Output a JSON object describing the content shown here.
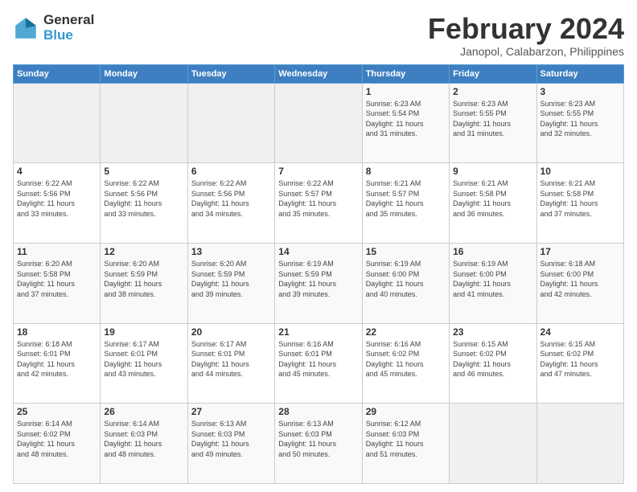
{
  "header": {
    "logo_general": "General",
    "logo_blue": "Blue",
    "month_title": "February 2024",
    "location": "Janopol, Calabarzon, Philippines"
  },
  "columns": [
    "Sunday",
    "Monday",
    "Tuesday",
    "Wednesday",
    "Thursday",
    "Friday",
    "Saturday"
  ],
  "weeks": [
    [
      {
        "day": "",
        "info": ""
      },
      {
        "day": "",
        "info": ""
      },
      {
        "day": "",
        "info": ""
      },
      {
        "day": "",
        "info": ""
      },
      {
        "day": "1",
        "info": "Sunrise: 6:23 AM\nSunset: 5:54 PM\nDaylight: 11 hours\nand 31 minutes."
      },
      {
        "day": "2",
        "info": "Sunrise: 6:23 AM\nSunset: 5:55 PM\nDaylight: 11 hours\nand 31 minutes."
      },
      {
        "day": "3",
        "info": "Sunrise: 6:23 AM\nSunset: 5:55 PM\nDaylight: 11 hours\nand 32 minutes."
      }
    ],
    [
      {
        "day": "4",
        "info": "Sunrise: 6:22 AM\nSunset: 5:56 PM\nDaylight: 11 hours\nand 33 minutes."
      },
      {
        "day": "5",
        "info": "Sunrise: 6:22 AM\nSunset: 5:56 PM\nDaylight: 11 hours\nand 33 minutes."
      },
      {
        "day": "6",
        "info": "Sunrise: 6:22 AM\nSunset: 5:56 PM\nDaylight: 11 hours\nand 34 minutes."
      },
      {
        "day": "7",
        "info": "Sunrise: 6:22 AM\nSunset: 5:57 PM\nDaylight: 11 hours\nand 35 minutes."
      },
      {
        "day": "8",
        "info": "Sunrise: 6:21 AM\nSunset: 5:57 PM\nDaylight: 11 hours\nand 35 minutes."
      },
      {
        "day": "9",
        "info": "Sunrise: 6:21 AM\nSunset: 5:58 PM\nDaylight: 11 hours\nand 36 minutes."
      },
      {
        "day": "10",
        "info": "Sunrise: 6:21 AM\nSunset: 5:58 PM\nDaylight: 11 hours\nand 37 minutes."
      }
    ],
    [
      {
        "day": "11",
        "info": "Sunrise: 6:20 AM\nSunset: 5:58 PM\nDaylight: 11 hours\nand 37 minutes."
      },
      {
        "day": "12",
        "info": "Sunrise: 6:20 AM\nSunset: 5:59 PM\nDaylight: 11 hours\nand 38 minutes."
      },
      {
        "day": "13",
        "info": "Sunrise: 6:20 AM\nSunset: 5:59 PM\nDaylight: 11 hours\nand 39 minutes."
      },
      {
        "day": "14",
        "info": "Sunrise: 6:19 AM\nSunset: 5:59 PM\nDaylight: 11 hours\nand 39 minutes."
      },
      {
        "day": "15",
        "info": "Sunrise: 6:19 AM\nSunset: 6:00 PM\nDaylight: 11 hours\nand 40 minutes."
      },
      {
        "day": "16",
        "info": "Sunrise: 6:19 AM\nSunset: 6:00 PM\nDaylight: 11 hours\nand 41 minutes."
      },
      {
        "day": "17",
        "info": "Sunrise: 6:18 AM\nSunset: 6:00 PM\nDaylight: 11 hours\nand 42 minutes."
      }
    ],
    [
      {
        "day": "18",
        "info": "Sunrise: 6:18 AM\nSunset: 6:01 PM\nDaylight: 11 hours\nand 42 minutes."
      },
      {
        "day": "19",
        "info": "Sunrise: 6:17 AM\nSunset: 6:01 PM\nDaylight: 11 hours\nand 43 minutes."
      },
      {
        "day": "20",
        "info": "Sunrise: 6:17 AM\nSunset: 6:01 PM\nDaylight: 11 hours\nand 44 minutes."
      },
      {
        "day": "21",
        "info": "Sunrise: 6:16 AM\nSunset: 6:01 PM\nDaylight: 11 hours\nand 45 minutes."
      },
      {
        "day": "22",
        "info": "Sunrise: 6:16 AM\nSunset: 6:02 PM\nDaylight: 11 hours\nand 45 minutes."
      },
      {
        "day": "23",
        "info": "Sunrise: 6:15 AM\nSunset: 6:02 PM\nDaylight: 11 hours\nand 46 minutes."
      },
      {
        "day": "24",
        "info": "Sunrise: 6:15 AM\nSunset: 6:02 PM\nDaylight: 11 hours\nand 47 minutes."
      }
    ],
    [
      {
        "day": "25",
        "info": "Sunrise: 6:14 AM\nSunset: 6:02 PM\nDaylight: 11 hours\nand 48 minutes."
      },
      {
        "day": "26",
        "info": "Sunrise: 6:14 AM\nSunset: 6:03 PM\nDaylight: 11 hours\nand 48 minutes."
      },
      {
        "day": "27",
        "info": "Sunrise: 6:13 AM\nSunset: 6:03 PM\nDaylight: 11 hours\nand 49 minutes."
      },
      {
        "day": "28",
        "info": "Sunrise: 6:13 AM\nSunset: 6:03 PM\nDaylight: 11 hours\nand 50 minutes."
      },
      {
        "day": "29",
        "info": "Sunrise: 6:12 AM\nSunset: 6:03 PM\nDaylight: 11 hours\nand 51 minutes."
      },
      {
        "day": "",
        "info": ""
      },
      {
        "day": "",
        "info": ""
      }
    ]
  ]
}
